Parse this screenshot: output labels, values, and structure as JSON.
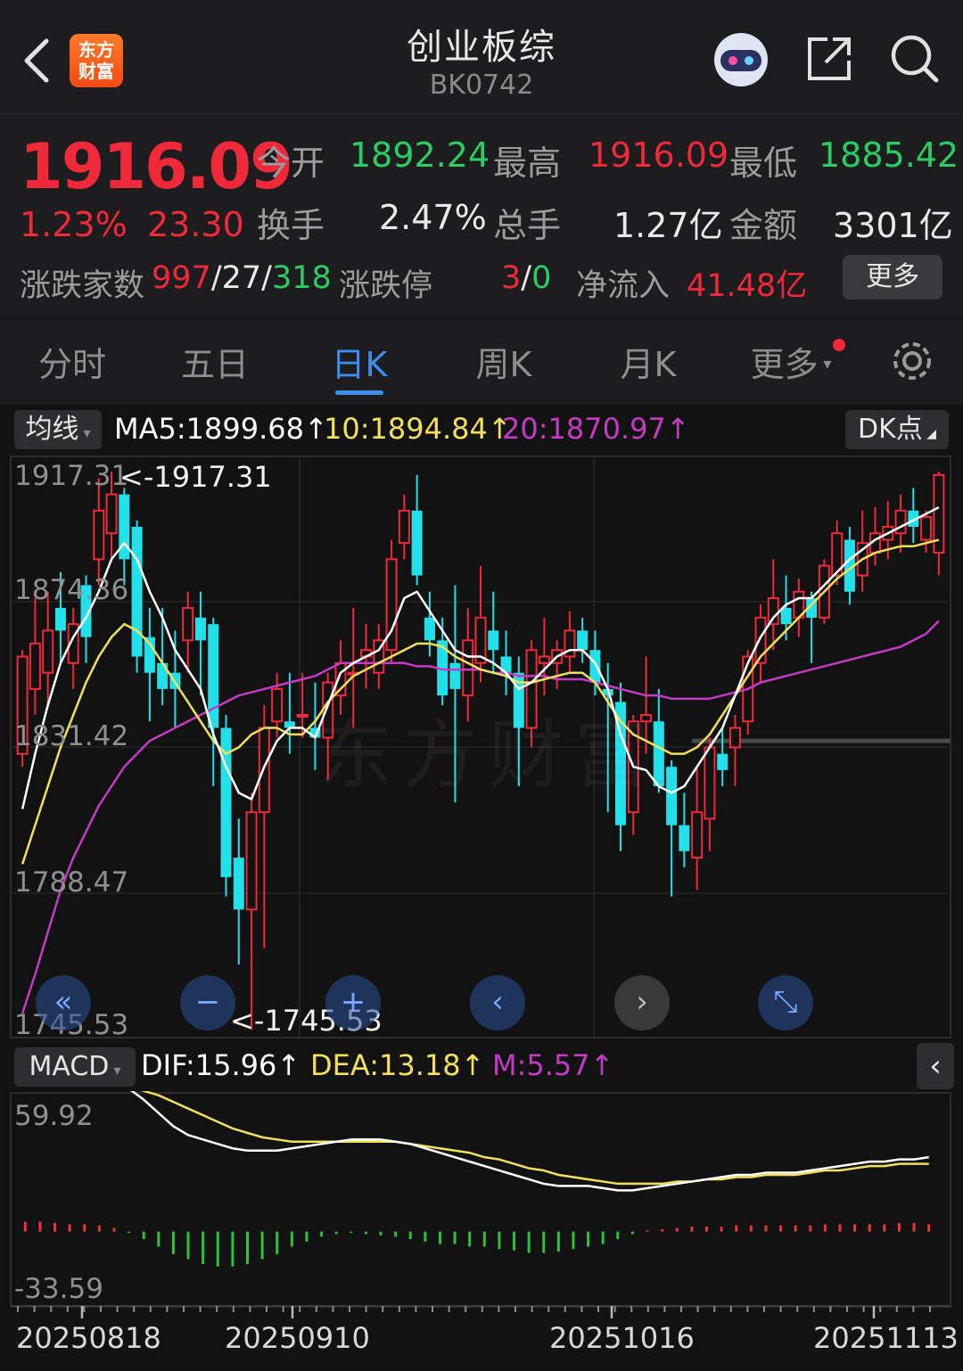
{
  "header": {
    "title": "创业板综",
    "code": "BK0742",
    "logo_text": "东方\n财富",
    "icons": [
      "back-icon",
      "robot-avatar-icon",
      "share-icon",
      "search-icon"
    ]
  },
  "quote": {
    "price": "1916.09",
    "pct": "1.23%",
    "change": "23.30",
    "open_label": "今开",
    "open": "1892.24",
    "high_label": "最高",
    "high": "1916.09",
    "low_label": "最低",
    "low": "1885.42",
    "turnover_label": "换手",
    "turnover": "2.47%",
    "volume_label": "总手",
    "volume": "1.27亿",
    "amount_label": "金额",
    "amount": "3301亿",
    "breadth_label": "涨跌家数",
    "up": "997",
    "flat": "27",
    "down": "318",
    "limit_label": "涨跌停",
    "limit_up": "3",
    "limit_down": "0",
    "netflow_label": "净流入",
    "netflow": "41.48亿",
    "more": "更多"
  },
  "tabs": [
    "分时",
    "五日",
    "日K",
    "周K",
    "月K",
    "更多"
  ],
  "active_tab": "日K",
  "ma_legend": {
    "selector": "均线",
    "ma5": "MA5:1899.68",
    "ma10": "10:1894.84",
    "ma20": "20:1870.97",
    "dk": "DK点"
  },
  "price_axis": [
    "1917.31",
    "1874.36",
    "1831.42",
    "1788.47",
    "1745.53"
  ],
  "max_marker": "<-1917.31",
  "min_marker": "<-1745.53",
  "macd_legend": {
    "selector": "MACD",
    "dif": "DIF:15.96",
    "dea": "DEA:13.18",
    "m": "M:5.57"
  },
  "macd_axis": [
    "59.92",
    "-33.59"
  ],
  "dates": [
    "20250818",
    "20250910",
    "20251016",
    "20251113"
  ],
  "watermark": "东方财富",
  "colors": {
    "up": "#f0293a",
    "down": "#22e0ea",
    "ma5": "#ffffff",
    "ma10": "#f2e05a",
    "ma20": "#c43ac4",
    "accent": "#3a8ff0"
  },
  "chart_data": {
    "type": "candlestick",
    "ylim": [
      1745.53,
      1917.31
    ],
    "candles": [
      [
        1830,
        1860,
        1862,
        1826
      ],
      [
        1850,
        1864,
        1878,
        1842
      ],
      [
        1855,
        1868,
        1880,
        1845
      ],
      [
        1875,
        1868,
        1886,
        1858
      ],
      [
        1858,
        1870,
        1875,
        1850
      ],
      [
        1882,
        1866,
        1885,
        1858
      ],
      [
        1890,
        1905,
        1915,
        1882
      ],
      [
        1898,
        1910,
        1917,
        1890
      ],
      [
        1910,
        1890,
        1912,
        1882
      ],
      [
        1900,
        1860,
        1902,
        1855
      ],
      [
        1866,
        1855,
        1875,
        1840
      ],
      [
        1858,
        1850,
        1875,
        1845
      ],
      [
        1855,
        1850,
        1868,
        1838
      ],
      [
        1865,
        1875,
        1880,
        1855
      ],
      [
        1872,
        1865,
        1880,
        1848
      ],
      [
        1870,
        1838,
        1872,
        1820
      ],
      [
        1838,
        1792,
        1842,
        1786
      ],
      [
        1798,
        1782,
        1810,
        1765
      ],
      [
        1782,
        1812,
        1818,
        1745
      ],
      [
        1812,
        1838,
        1845,
        1770
      ],
      [
        1840,
        1850,
        1855,
        1835
      ],
      [
        1840,
        1838,
        1855,
        1830
      ],
      [
        1842,
        1842,
        1855,
        1835
      ],
      [
        1838,
        1835,
        1852,
        1825
      ],
      [
        1835,
        1852,
        1855,
        1822
      ],
      [
        1848,
        1858,
        1865,
        1842
      ],
      [
        1855,
        1855,
        1875,
        1838
      ],
      [
        1860,
        1862,
        1870,
        1850
      ],
      [
        1855,
        1865,
        1870,
        1850
      ],
      [
        1862,
        1890,
        1896,
        1858
      ],
      [
        1895,
        1905,
        1910,
        1890
      ],
      [
        1905,
        1885,
        1916,
        1882
      ],
      [
        1872,
        1865,
        1880,
        1860
      ],
      [
        1865,
        1848,
        1872,
        1845
      ],
      [
        1858,
        1850,
        1882,
        1815
      ],
      [
        1848,
        1865,
        1875,
        1840
      ],
      [
        1858,
        1872,
        1888,
        1852
      ],
      [
        1868,
        1862,
        1880,
        1855
      ],
      [
        1860,
        1855,
        1868,
        1848
      ],
      [
        1855,
        1838,
        1860,
        1820
      ],
      [
        1838,
        1862,
        1865,
        1832
      ],
      [
        1858,
        1860,
        1872,
        1848
      ],
      [
        1858,
        1862,
        1865,
        1850
      ],
      [
        1860,
        1868,
        1874,
        1855
      ],
      [
        1868,
        1862,
        1872,
        1858
      ],
      [
        1862,
        1852,
        1868,
        1848
      ],
      [
        1850,
        1848,
        1858,
        1812
      ],
      [
        1846,
        1808,
        1852,
        1800
      ],
      [
        1812,
        1840,
        1842,
        1805
      ],
      [
        1840,
        1842,
        1860,
        1830
      ],
      [
        1840,
        1820,
        1850,
        1818
      ],
      [
        1826,
        1808,
        1828,
        1786
      ],
      [
        1808,
        1800,
        1818,
        1795
      ],
      [
        1798,
        1812,
        1826,
        1788
      ],
      [
        1810,
        1832,
        1835,
        1800
      ],
      [
        1830,
        1825,
        1838,
        1820
      ],
      [
        1832,
        1838,
        1842,
        1820
      ],
      [
        1840,
        1860,
        1862,
        1836
      ],
      [
        1858,
        1872,
        1876,
        1852
      ],
      [
        1870,
        1878,
        1890,
        1862
      ],
      [
        1875,
        1870,
        1885,
        1865
      ],
      [
        1872,
        1880,
        1884,
        1866
      ],
      [
        1878,
        1872,
        1880,
        1858
      ],
      [
        1872,
        1888,
        1890,
        1870
      ],
      [
        1885,
        1898,
        1902,
        1882
      ],
      [
        1896,
        1880,
        1900,
        1876
      ],
      [
        1885,
        1895,
        1905,
        1880
      ],
      [
        1892,
        1898,
        1906,
        1888
      ],
      [
        1896,
        1900,
        1908,
        1890
      ],
      [
        1898,
        1905,
        1910,
        1892
      ],
      [
        1905,
        1900,
        1912,
        1895
      ],
      [
        1896,
        1903,
        1905,
        1892
      ],
      [
        1892,
        1916,
        1917,
        1885
      ]
    ],
    "ma5": [
      1813,
      1830,
      1845,
      1858,
      1866,
      1872,
      1880,
      1890,
      1895,
      1890,
      1880,
      1872,
      1862,
      1856,
      1850,
      1836,
      1826,
      1818,
      1816,
      1826,
      1834,
      1838,
      1838,
      1835,
      1845,
      1855,
      1858,
      1860,
      1862,
      1868,
      1878,
      1880,
      1874,
      1868,
      1862,
      1860,
      1860,
      1858,
      1855,
      1850,
      1852,
      1856,
      1860,
      1862,
      1862,
      1858,
      1850,
      1836,
      1826,
      1825,
      1820,
      1818,
      1820,
      1826,
      1832,
      1838,
      1848,
      1858,
      1866,
      1872,
      1876,
      1878,
      1878,
      1882,
      1886,
      1890,
      1893,
      1896,
      1898,
      1900,
      1902,
      1904,
      1906
    ],
    "ma10": [
      1796,
      1808,
      1820,
      1832,
      1842,
      1852,
      1860,
      1866,
      1870,
      1868,
      1864,
      1858,
      1852,
      1846,
      1840,
      1834,
      1830,
      1832,
      1836,
      1838,
      1838,
      1836,
      1836,
      1840,
      1846,
      1850,
      1854,
      1856,
      1858,
      1860,
      1862,
      1864,
      1864,
      1863,
      1860,
      1858,
      1856,
      1855,
      1854,
      1852,
      1852,
      1853,
      1854,
      1855,
      1855,
      1852,
      1846,
      1840,
      1836,
      1834,
      1832,
      1830,
      1830,
      1832,
      1836,
      1842,
      1848,
      1854,
      1860,
      1864,
      1868,
      1872,
      1876,
      1880,
      1884,
      1887,
      1890,
      1892,
      1893,
      1894,
      1894,
      1895,
      1896
    ],
    "ma20": [
      1750,
      1762,
      1775,
      1788,
      1798,
      1806,
      1814,
      1820,
      1826,
      1830,
      1834,
      1836,
      1838,
      1840,
      1842,
      1844,
      1846,
      1848,
      1849,
      1850,
      1851,
      1852,
      1853,
      1854,
      1856,
      1858,
      1858,
      1858,
      1858,
      1858,
      1858,
      1857,
      1857,
      1856,
      1856,
      1856,
      1856,
      1855,
      1855,
      1854,
      1854,
      1854,
      1853,
      1853,
      1853,
      1852,
      1851,
      1850,
      1849,
      1848,
      1848,
      1847,
      1847,
      1847,
      1847,
      1848,
      1849,
      1850,
      1852,
      1853,
      1854,
      1855,
      1856,
      1857,
      1858,
      1859,
      1860,
      1861,
      1862,
      1863,
      1865,
      1867,
      1871
    ],
    "macd_ylim": [
      -33.59,
      59.92
    ],
    "dif": [
      62,
      64,
      65,
      65,
      64,
      62,
      60,
      57,
      52,
      46,
      40,
      36,
      34,
      32,
      30,
      29,
      29,
      29,
      30,
      31,
      32,
      33,
      34,
      34,
      34,
      33,
      32,
      30,
      28,
      26,
      24,
      22,
      20,
      18,
      16,
      14,
      13,
      13,
      13,
      12,
      11,
      11,
      12,
      13,
      14,
      15,
      16,
      17,
      18,
      18,
      19,
      19,
      19,
      20,
      21,
      22,
      23,
      24,
      24,
      25,
      25,
      26
    ],
    "dea": [
      58,
      59,
      60,
      61,
      61,
      60,
      59,
      58,
      56,
      54,
      51,
      48,
      45,
      42,
      39,
      37,
      35,
      34,
      33,
      33,
      33,
      33,
      33,
      33,
      33,
      33,
      32,
      31,
      30,
      29,
      28,
      26,
      25,
      23,
      21,
      20,
      18,
      17,
      16,
      15,
      14,
      14,
      14,
      14,
      15,
      15,
      16,
      16,
      17,
      17,
      18,
      18,
      18,
      19,
      20,
      20,
      21,
      22,
      22,
      23,
      23,
      23
    ],
    "macd_hist": [
      8,
      8,
      7,
      6,
      6,
      5,
      3,
      -1,
      -6,
      -12,
      -18,
      -22,
      -26,
      -28,
      -28,
      -26,
      -22,
      -18,
      -12,
      -8,
      -4,
      -2,
      -1,
      -2,
      -3,
      -4,
      -6,
      -8,
      -10,
      -10,
      -12,
      -12,
      -14,
      -15,
      -17,
      -17,
      -16,
      -14,
      -12,
      -10,
      -6,
      -2,
      1,
      2,
      3,
      4,
      4,
      4,
      5,
      5,
      5,
      5,
      5,
      5,
      6,
      6,
      6,
      6,
      6,
      7,
      7,
      6
    ]
  }
}
